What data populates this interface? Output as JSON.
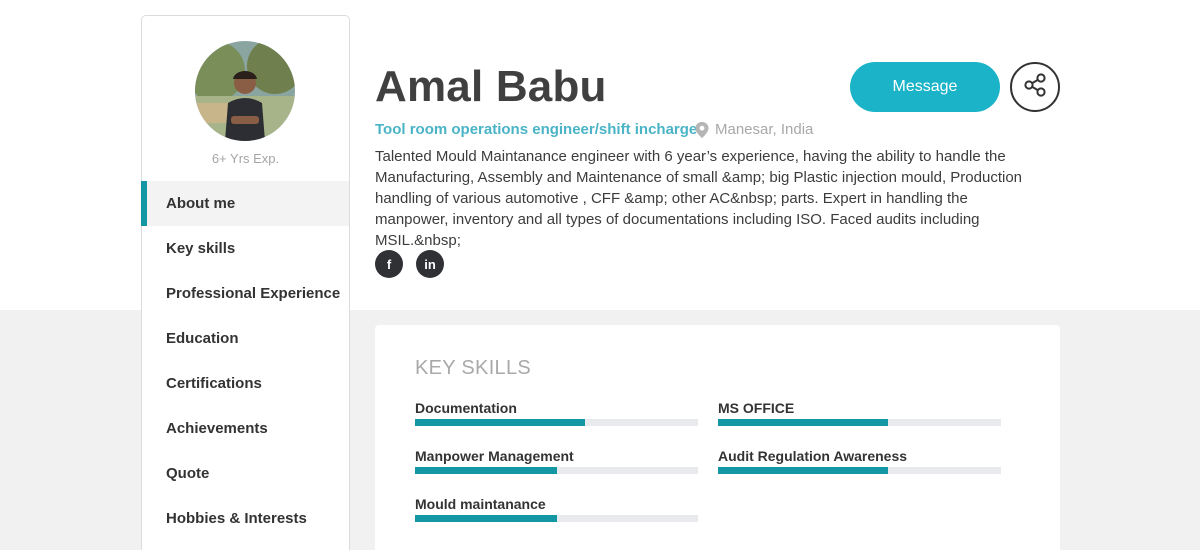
{
  "sidebar": {
    "experience": "6+ Yrs Exp.",
    "nav": [
      {
        "label": "About me",
        "active": true
      },
      {
        "label": "Key skills",
        "active": false
      },
      {
        "label": "Professional Experience",
        "active": false
      },
      {
        "label": "Education",
        "active": false
      },
      {
        "label": "Certifications",
        "active": false
      },
      {
        "label": "Achievements",
        "active": false
      },
      {
        "label": "Quote",
        "active": false
      },
      {
        "label": "Hobbies & Interests",
        "active": false
      }
    ]
  },
  "profile": {
    "name": "Amal Babu",
    "role": "Tool room operations engineer/shift incharge",
    "location": "Manesar, India",
    "bio": "Talented Mould Maintanance engineer with 6 year’s experience, having the ability to handle the Manufacturing, Assembly and Maintenance of small &amp; big Plastic injection mould, Production handling of various automotive , CFF &amp; other AC&nbsp; parts. Expert in handling the manpower, inventory and all types of documentations including ISO. Faced audits including MSIL.&nbsp;",
    "social": {
      "facebook": "f",
      "linkedin": "in"
    }
  },
  "actions": {
    "message_label": "Message"
  },
  "skills_card": {
    "title": "KEY SKILLS",
    "skills": [
      {
        "name": "Documentation",
        "level": 0.6
      },
      {
        "name": "MS OFFICE",
        "level": 0.6
      },
      {
        "name": "Manpower Management",
        "level": 0.5
      },
      {
        "name": "Audit Regulation Awareness",
        "level": 0.6
      },
      {
        "name": "Mould maintanance",
        "level": 0.5
      }
    ]
  },
  "colors": {
    "accent": "#1ab3c8",
    "bar_fill": "#1497a5",
    "role_text": "#4ab4c6"
  }
}
